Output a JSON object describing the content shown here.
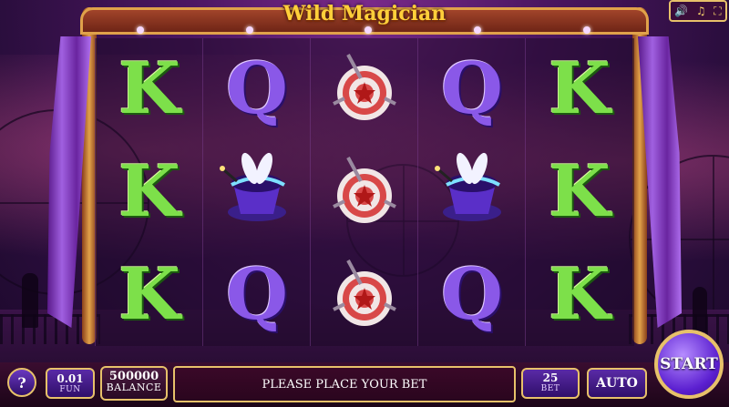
{
  "game": {
    "title": "Wild Magician"
  },
  "settings": {
    "sound_icon": "🔊",
    "music_icon": "♫",
    "fullscreen_icon": "⛶"
  },
  "reels": [
    [
      "K",
      "K",
      "K"
    ],
    [
      "Q",
      "magic-hat",
      "Q"
    ],
    [
      "dartboard",
      "dartboard",
      "dartboard"
    ],
    [
      "Q",
      "magic-hat",
      "Q"
    ],
    [
      "K",
      "K",
      "K"
    ]
  ],
  "controls": {
    "help_label": "?",
    "coin_value": "0.01",
    "coin_label": "FUN",
    "balance_value": "500000",
    "balance_label": "BALANCE",
    "message": "PLEASE PLACE YOUR BET",
    "bet_value": "25",
    "bet_label": "BET",
    "auto_label": "AUTO",
    "start_label": "START"
  }
}
